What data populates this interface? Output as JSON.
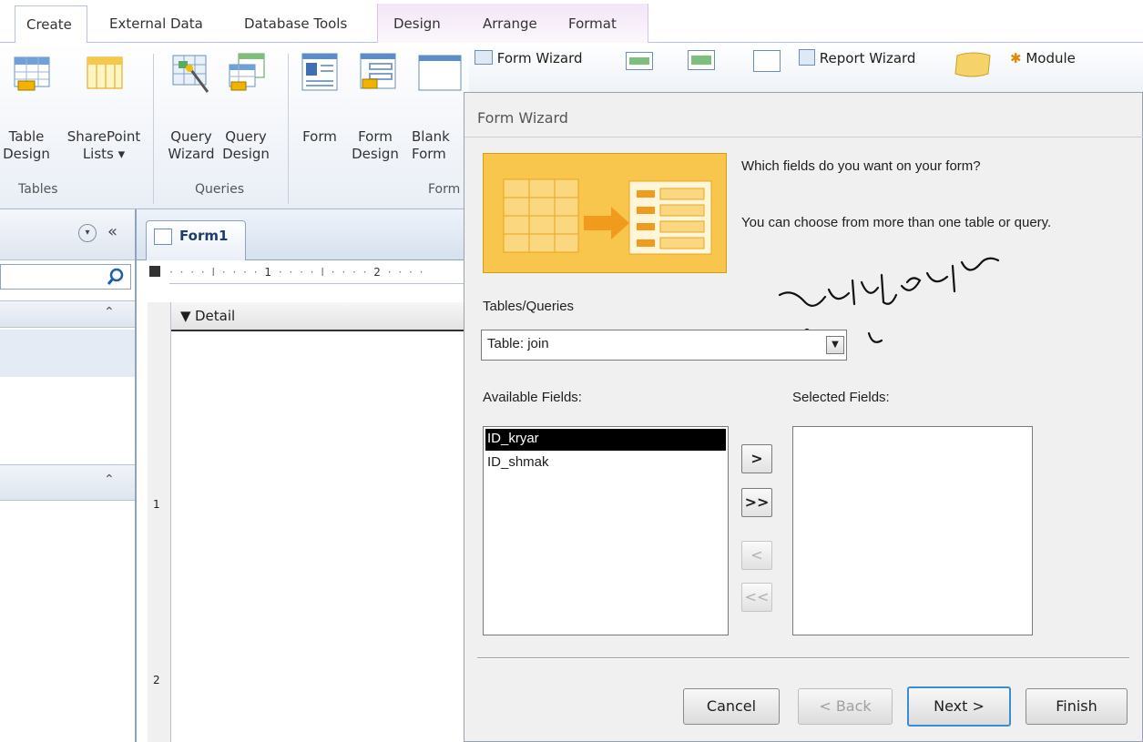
{
  "tabs": [
    {
      "label": "Create",
      "active": true
    },
    {
      "label": "External Data"
    },
    {
      "label": "Database Tools"
    },
    {
      "label": "Design"
    },
    {
      "label": "Arrange"
    },
    {
      "label": "Format"
    }
  ],
  "ribbon": {
    "table_design": [
      "Table",
      "Design"
    ],
    "sharepoint_lists": [
      "SharePoint",
      "Lists ▾"
    ],
    "query_wizard": [
      "Query",
      "Wizard"
    ],
    "query_design": [
      "Query",
      "Design"
    ],
    "form": "Form",
    "form_design": [
      "Form",
      "Design"
    ],
    "blank_form": [
      "Blank",
      "Form"
    ],
    "groups": {
      "tables": "Tables",
      "queries": "Queries",
      "forms": "Form"
    },
    "form_wizard": "Form Wizard",
    "report_wizard": "Report Wizard",
    "module": "Module"
  },
  "document": {
    "tab_label": "Form1",
    "section_label": "Detail",
    "ruler_marks": [
      "1",
      "2"
    ],
    "vruler_marks": [
      "1",
      "2"
    ]
  },
  "wizard": {
    "title": "Form Wizard",
    "question": "Which fields do you want on your form?",
    "hint": "You can choose from more than one table or query.",
    "tables_label": "Tables/Queries",
    "tables_value": "Table: join",
    "available_label": "Available Fields:",
    "selected_label": "Selected Fields:",
    "available_fields": [
      "ID_kryar",
      "ID_shmak"
    ],
    "selected_index": 0,
    "move_one": ">",
    "move_all": ">>",
    "remove_one": "<",
    "remove_all": "<<",
    "buttons": {
      "cancel": "Cancel",
      "back": "< Back",
      "next": "Next >",
      "finish": "Finish"
    }
  },
  "annotation_text": "سەرچاوە دیاری بکە"
}
